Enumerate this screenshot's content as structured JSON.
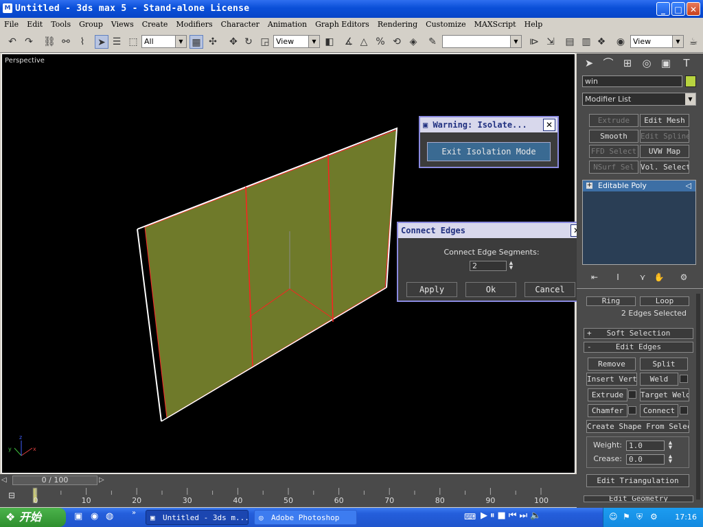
{
  "window": {
    "title": "Untitled - 3ds max 5 - Stand-alone License",
    "minimize": "_",
    "maximize": "□",
    "close": "✕"
  },
  "menu": [
    "File",
    "Edit",
    "Tools",
    "Group",
    "Views",
    "Create",
    "Modifiers",
    "Character",
    "Animation",
    "Graph Editors",
    "Rendering",
    "Customize",
    "MAXScript",
    "Help"
  ],
  "toolbar": {
    "selection_filter": "All",
    "ref_coord": "View",
    "named_selection": "",
    "render_type": "View"
  },
  "viewport": {
    "label": "Perspective",
    "axis_labels": {
      "x": "x",
      "y": "y",
      "z": "z"
    },
    "colors": {
      "plane": "#6f7a2a",
      "edges": "#ff2020",
      "outline": "#ffffff"
    }
  },
  "isolate_dialog": {
    "title": "Warning: Isolate...",
    "button": "Exit Isolation Mode"
  },
  "connect_dialog": {
    "title": "Connect Edges",
    "field_label": "Connect Edge Segments:",
    "segments": "2",
    "apply": "Apply",
    "ok": "Ok",
    "cancel": "Cancel"
  },
  "panel": {
    "object_name": "win",
    "object_color": "#b8d440",
    "modifier_list": "Modifier List",
    "modifier_buttons": [
      "Extrude",
      "Edit Mesh",
      "Smooth",
      "Edit Spline",
      "FFD Select",
      "UVW Map",
      "NSurf Sel",
      "Vol. Select"
    ],
    "stack_item": "Editable Poly",
    "ring": "Ring",
    "loop": "Loop",
    "selection_status": "2 Edges Selected",
    "soft_selection": "Soft Selection",
    "soft_selection_sign": "+",
    "edit_edges": "Edit Edges",
    "edit_edges_sign": "-",
    "remove": "Remove",
    "split": "Split",
    "insert_vertex": "Insert Vertex",
    "weld": "Weld",
    "extrude": "Extrude",
    "target_weld": "Target Weld",
    "chamfer": "Chamfer",
    "connect": "Connect",
    "create_shape": "Create Shape From Selection",
    "weight_label": "Weight:",
    "weight": "1.0",
    "crease_label": "Crease:",
    "crease": "0.0",
    "edit_triangulation": "Edit Triangulation",
    "edit_geometry": "Edit Geometry"
  },
  "timeline": {
    "frame": "0 / 100",
    "ticks": [
      "0",
      "10",
      "20",
      "30",
      "40",
      "50",
      "60",
      "70",
      "80",
      "90",
      "100"
    ]
  },
  "taskbar": {
    "start": "开始",
    "tasks": [
      "Untitled - 3ds m...",
      "Adobe Photoshop"
    ],
    "clock": "17:16"
  }
}
